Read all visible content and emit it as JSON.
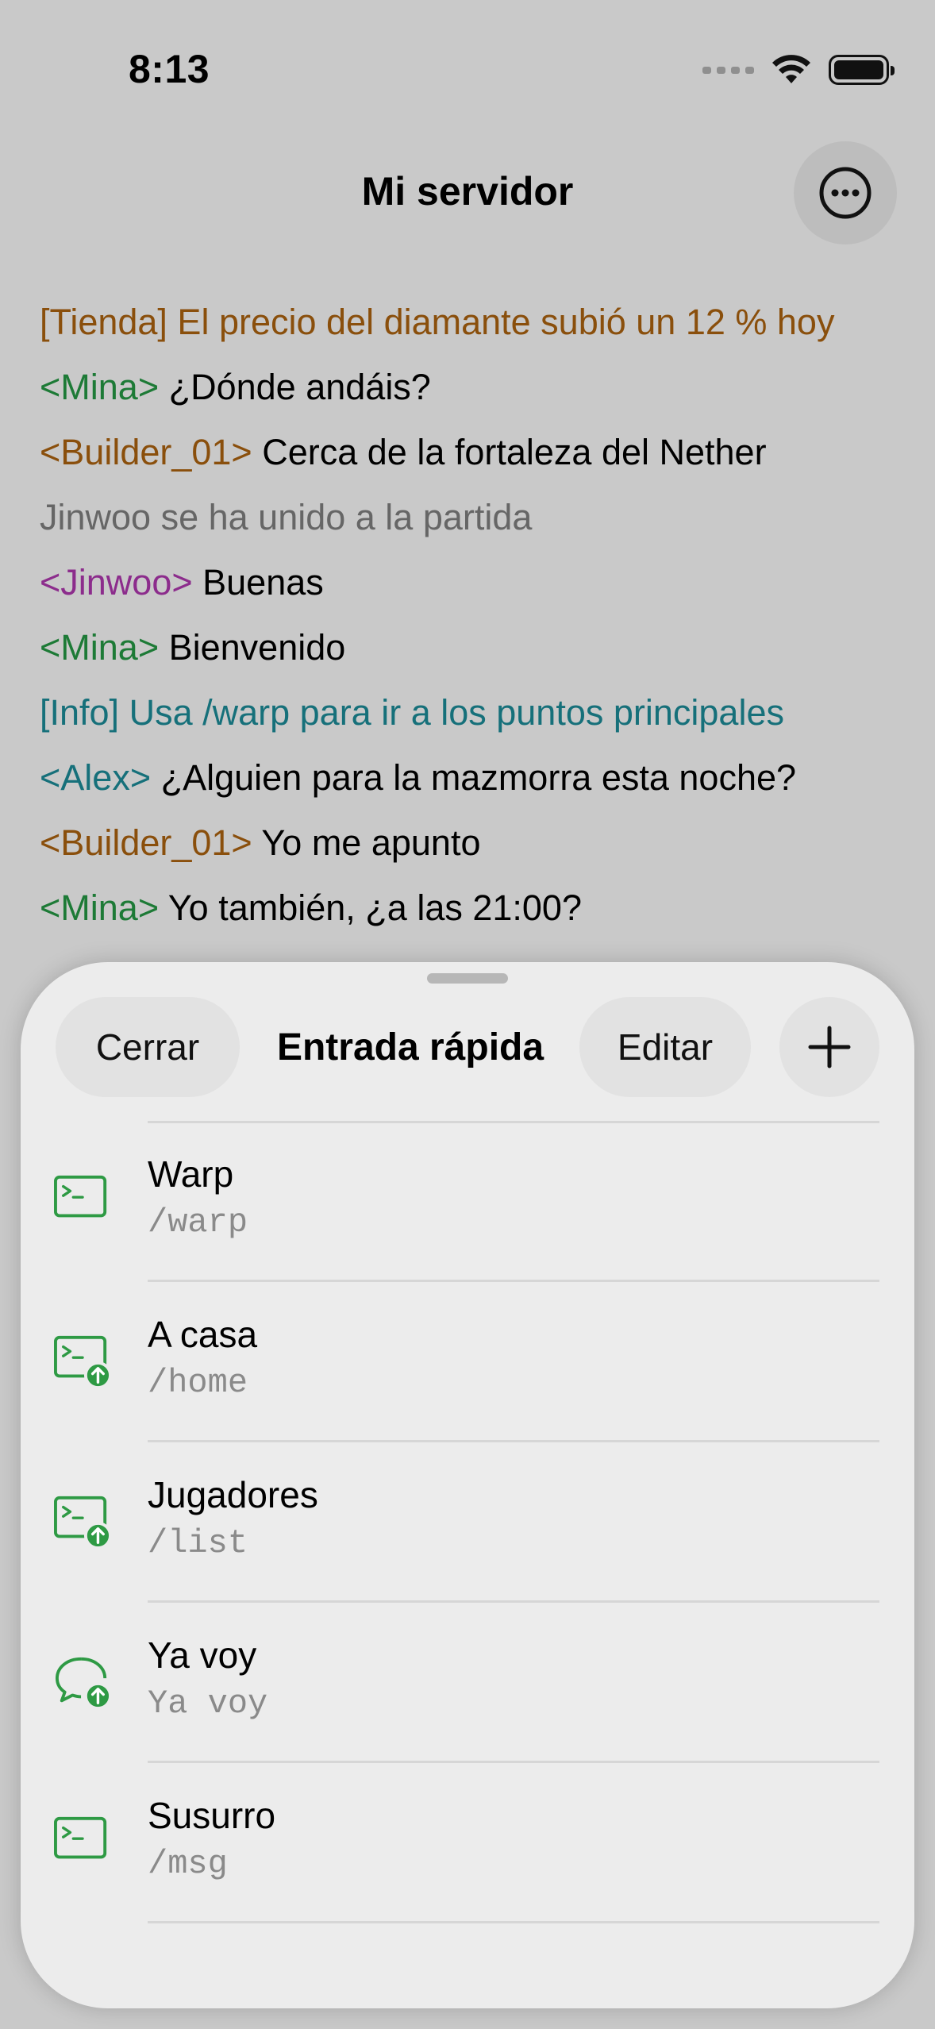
{
  "status_bar": {
    "time": "8:13"
  },
  "nav": {
    "title": "Mi servidor"
  },
  "chat": [
    {
      "segments": [
        {
          "text": "[Tienda] El precio del diamante subió un 12 % hoy",
          "color": "orange"
        }
      ]
    },
    {
      "segments": [
        {
          "text": "<Mina>",
          "color": "green"
        },
        {
          "text": " ¿Dónde andáis?",
          "color": "black"
        }
      ]
    },
    {
      "segments": [
        {
          "text": "<Builder_01>",
          "color": "orange"
        },
        {
          "text": " Cerca de la fortaleza del Nether",
          "color": "black"
        }
      ]
    },
    {
      "segments": [
        {
          "text": "Jinwoo se ha unido a la partida",
          "color": "gray"
        }
      ]
    },
    {
      "segments": [
        {
          "text": "<Jinwoo>",
          "color": "purple"
        },
        {
          "text": " Buenas",
          "color": "black"
        }
      ]
    },
    {
      "segments": [
        {
          "text": "<Mina>",
          "color": "green"
        },
        {
          "text": " Bienvenido",
          "color": "black"
        }
      ]
    },
    {
      "segments": [
        {
          "text": "[Info] Usa /warp para ir a los puntos principales",
          "color": "teal"
        }
      ]
    },
    {
      "segments": [
        {
          "text": "<Alex>",
          "color": "teal"
        },
        {
          "text": " ¿Alguien para la mazmorra esta noche?",
          "color": "black"
        }
      ]
    },
    {
      "segments": [
        {
          "text": "<Builder_01>",
          "color": "orange"
        },
        {
          "text": " Yo me apunto",
          "color": "black"
        }
      ]
    },
    {
      "segments": [
        {
          "text": "<Mina>",
          "color": "green"
        },
        {
          "text": " Yo también, ¿a las 21:00?",
          "color": "black"
        }
      ]
    }
  ],
  "sheet": {
    "close_label": "Cerrar",
    "title": "Entrada rápida",
    "edit_label": "Editar",
    "add_label": "+",
    "items": [
      {
        "title": "Warp",
        "subtitle": "/warp",
        "icon": "terminal-icon"
      },
      {
        "title": "A casa",
        "subtitle": "/home",
        "icon": "terminal-send-icon"
      },
      {
        "title": "Jugadores",
        "subtitle": "/list",
        "icon": "terminal-send-icon"
      },
      {
        "title": "Ya voy",
        "subtitle": "Ya voy",
        "icon": "chat-send-icon"
      },
      {
        "title": "Susurro",
        "subtitle": "/msg",
        "icon": "terminal-icon"
      }
    ]
  },
  "colors": {
    "accent_green": "#2e9a44",
    "orange": "#8a4f0c",
    "green": "#1d7a36",
    "gray": "#666666",
    "purple": "#8c2c8c",
    "teal": "#16707a",
    "black": "#000000"
  }
}
